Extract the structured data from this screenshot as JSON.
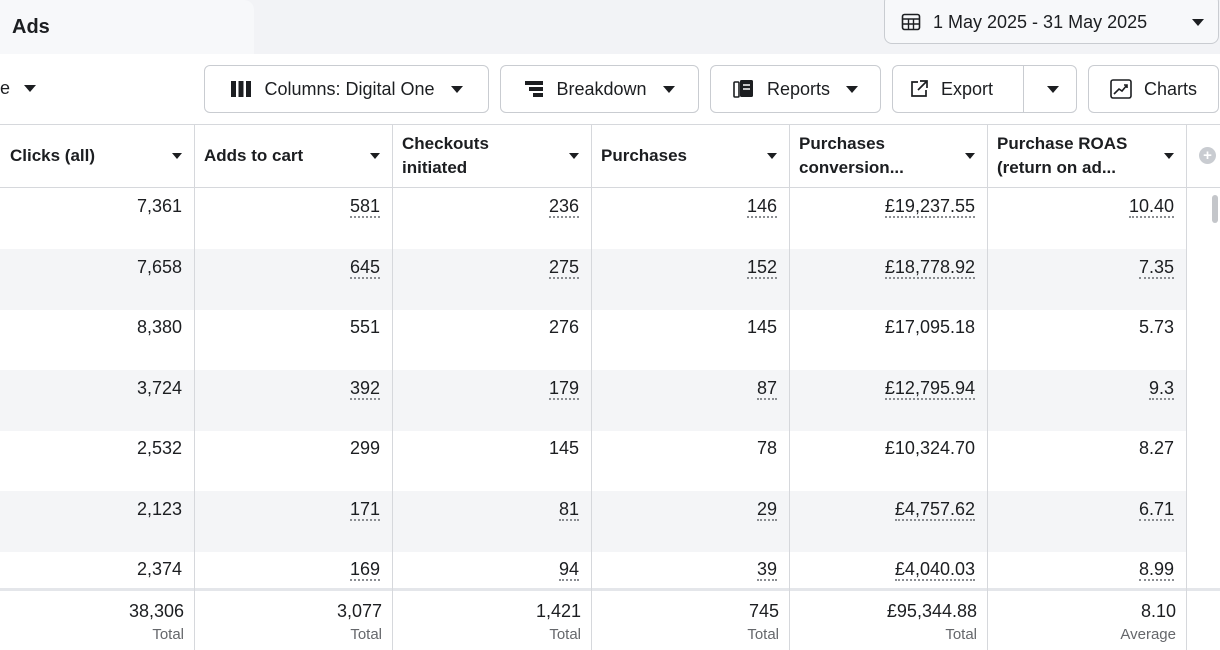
{
  "tab": {
    "label": "Ads"
  },
  "date_range": {
    "label": "1 May 2025 - 31 May 2025"
  },
  "toolbar": {
    "left_truncated": "e",
    "columns_label": "Columns: Digital One",
    "breakdown_label": "Breakdown",
    "reports_label": "Reports",
    "export_label": "Export",
    "charts_label": "Charts"
  },
  "table": {
    "headers": [
      {
        "line1": "Clicks (all)",
        "line2": ""
      },
      {
        "line1": "Adds to cart",
        "line2": ""
      },
      {
        "line1": "Checkouts",
        "line2": "initiated"
      },
      {
        "line1": "Purchases",
        "line2": ""
      },
      {
        "line1": "Purchases",
        "line2": "conversion..."
      },
      {
        "line1": "Purchase ROAS",
        "line2": "(return on ad..."
      }
    ],
    "rows": [
      [
        "7,361",
        "581",
        "236",
        "146",
        "£19,237.55",
        "10.40"
      ],
      [
        "7,658",
        "645",
        "275",
        "152",
        "£18,778.92",
        "7.35"
      ],
      [
        "8,380",
        "551",
        "276",
        "145",
        "£17,095.18",
        "5.73"
      ],
      [
        "3,724",
        "392",
        "179",
        "87",
        "£12,795.94",
        "9.3"
      ],
      [
        "2,532",
        "299",
        "145",
        "78",
        "£10,324.70",
        "8.27"
      ],
      [
        "2,123",
        "171",
        "81",
        "29",
        "£4,757.62",
        "6.71"
      ],
      [
        "2,374",
        "169",
        "94",
        "39",
        "£4,040.03",
        "8.99"
      ]
    ],
    "row_links": [
      true,
      true,
      false,
      true,
      false,
      true,
      true
    ],
    "totals": [
      {
        "value": "38,306",
        "label": "Total"
      },
      {
        "value": "3,077",
        "label": "Total"
      },
      {
        "value": "1,421",
        "label": "Total"
      },
      {
        "value": "745",
        "label": "Total"
      },
      {
        "value": "£95,344.88",
        "label": "Total"
      },
      {
        "value": "8.10",
        "label": "Average"
      }
    ]
  }
}
